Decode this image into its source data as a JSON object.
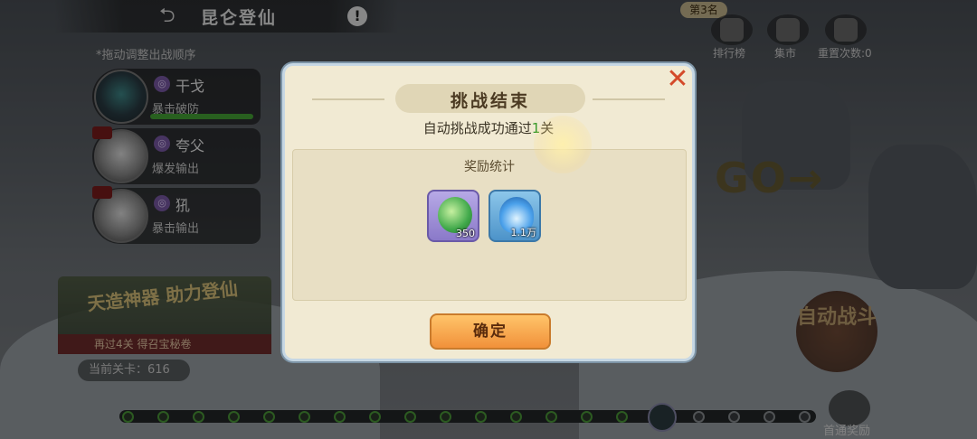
{
  "header": {
    "title": "昆仑登仙",
    "help_icon": "!"
  },
  "hint": "*拖动调整出战顺序",
  "heroes": [
    {
      "name": "干戈",
      "role": "暴击破防"
    },
    {
      "name": "夸父",
      "role": "爆发输出"
    },
    {
      "name": "犼",
      "role": "暴击输出"
    }
  ],
  "promo": {
    "title": "天造神器 助力登仙",
    "subtitle": "再过4关 得召宝秘卷"
  },
  "stage_label": "当前关卡：616",
  "top_right": {
    "rank_tag": "第3名",
    "rank_label": "排行榜",
    "market_label": "集市",
    "reset_label": "重置次数:0"
  },
  "go_text": "GO→",
  "auto_battle_label": "自动战斗",
  "first_reward_label": "首通奖励",
  "dialog": {
    "title": "挑战结束",
    "summary_prefix": "自动挑战成功通过",
    "summary_count": "1",
    "summary_suffix": "关",
    "rewards_title": "奖励统计",
    "rewards": [
      {
        "icon": "jade-icon",
        "qty": "350"
      },
      {
        "icon": "blue-flame-icon",
        "qty": "1.1万"
      }
    ],
    "confirm_label": "确定",
    "close_icon": "✕"
  }
}
